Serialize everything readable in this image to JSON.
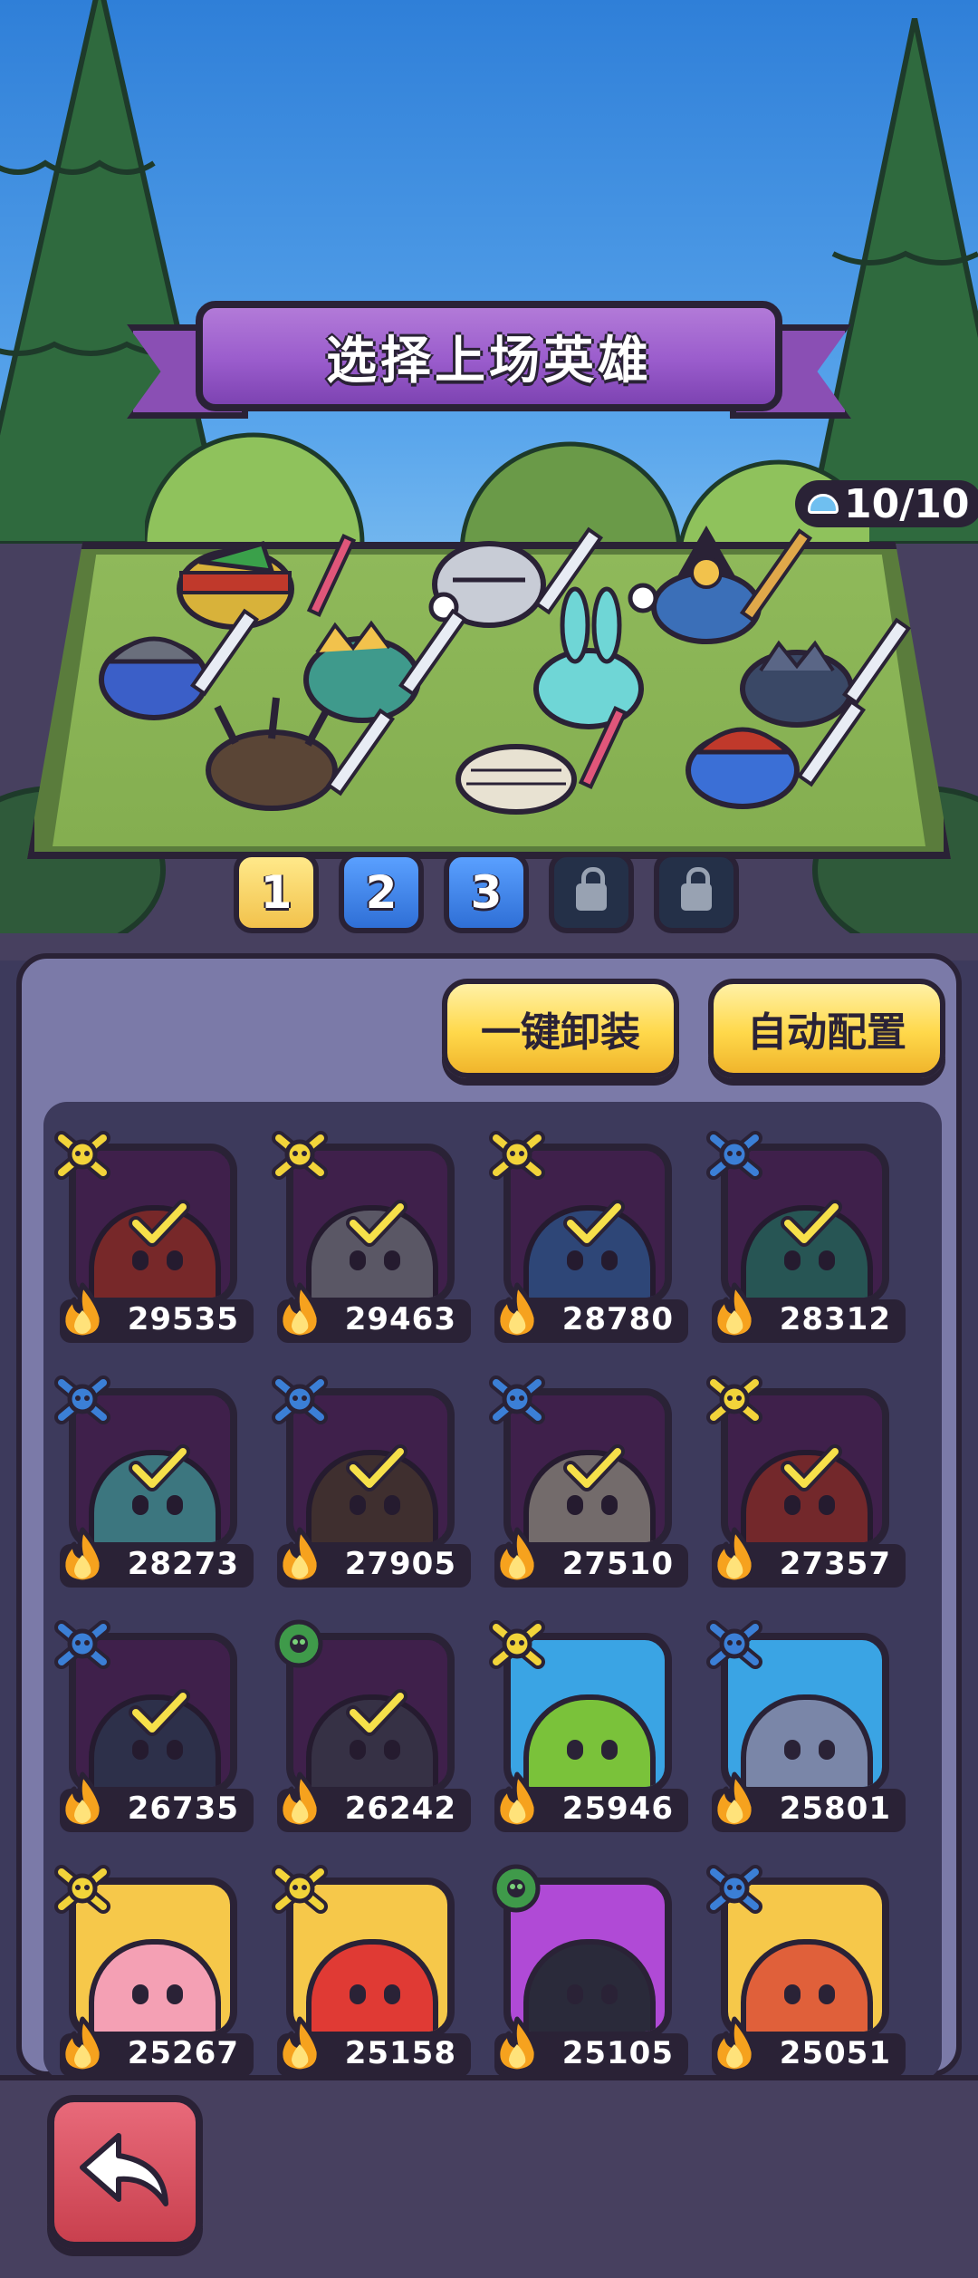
{
  "title": "选择上场英雄",
  "capacity": "10/10",
  "tabs": [
    {
      "label": "1",
      "state": "active"
    },
    {
      "label": "2",
      "state": "available"
    },
    {
      "label": "3",
      "state": "available"
    },
    {
      "label": "",
      "state": "locked"
    },
    {
      "label": "",
      "state": "locked"
    }
  ],
  "buttons": {
    "unequip_all": "一键卸装",
    "auto_config": "自动配置"
  },
  "heroes": [
    {
      "power": "29535",
      "rank": "gold-bone-icon",
      "bg": "#5a2a68",
      "color": "#c0392b",
      "selected": true
    },
    {
      "power": "29463",
      "rank": "gold-bone-icon",
      "bg": "#5a2a68",
      "color": "#8a8f98",
      "selected": true
    },
    {
      "power": "28780",
      "rank": "gold-bone-icon",
      "bg": "#5a2a68",
      "color": "#3b6fb8",
      "selected": true
    },
    {
      "power": "28312",
      "rank": "blue-bone-icon",
      "bg": "#5a2a68",
      "color": "#2f8a78",
      "selected": true
    },
    {
      "power": "28273",
      "rank": "blue-bone-icon",
      "bg": "#5a2a68",
      "color": "#55c7c7",
      "selected": true
    },
    {
      "power": "27905",
      "rank": "blue-bone-icon",
      "bg": "#5a2a68",
      "color": "#5a4536",
      "selected": true
    },
    {
      "power": "27510",
      "rank": "blue-bone-icon",
      "bg": "#5a2a68",
      "color": "#b8b2a2",
      "selected": true
    },
    {
      "power": "27357",
      "rank": "gold-bone-icon",
      "bg": "#5a2a68",
      "color": "#b83a2e",
      "selected": true
    },
    {
      "power": "26735",
      "rank": "blue-bone-icon",
      "bg": "#5a2a68",
      "color": "#3a4866",
      "selected": true
    },
    {
      "power": "26242",
      "rank": "green-gear-icon",
      "bg": "#5a2a68",
      "color": "#4a4a5e",
      "selected": true
    },
    {
      "power": "25946",
      "rank": "gold-bone-icon",
      "bg": "#3aa4e4",
      "color": "#7ac23a",
      "selected": false
    },
    {
      "power": "25801",
      "rank": "blue-bone-icon",
      "bg": "#3aa4e4",
      "color": "#7a86a8",
      "selected": false
    },
    {
      "power": "25267",
      "rank": "gold-bone-icon",
      "bg": "#f6c84a",
      "color": "#f4a0b4",
      "selected": false
    },
    {
      "power": "25158",
      "rank": "gold-bone-icon",
      "bg": "#f6c84a",
      "color": "#e03a34",
      "selected": false
    },
    {
      "power": "25105",
      "rank": "green-gear-icon",
      "bg": "#b04ad6",
      "color": "#2a2a3a",
      "selected": false
    },
    {
      "power": "25051",
      "rank": "blue-bone-icon",
      "bg": "#f6c84a",
      "color": "#e0603a",
      "selected": false
    }
  ],
  "colors": {
    "accent_yellow": "#ffd84a",
    "tab_blue": "#2f6fd6",
    "panel": "#7b7aa8",
    "outline": "#2a2236",
    "back_button": "#c9404e"
  }
}
